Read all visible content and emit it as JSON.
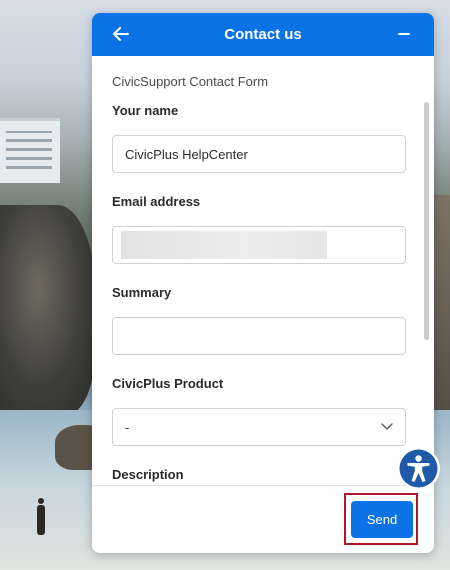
{
  "header": {
    "title": "Contact us",
    "back_icon": "arrow-left-icon",
    "minimize_icon": "minus-icon"
  },
  "form": {
    "title": "CivicSupport Contact Form",
    "fields": {
      "name": {
        "label": "Your name",
        "value": "CivicPlus HelpCenter"
      },
      "email": {
        "label": "Email address",
        "value": ""
      },
      "summary": {
        "label": "Summary",
        "value": ""
      },
      "product": {
        "label": "CivicPlus Product",
        "value": "-"
      },
      "description": {
        "label": "Description"
      }
    }
  },
  "footer": {
    "send_label": "Send"
  },
  "colors": {
    "accent": "#0b72e7",
    "highlight_border": "#b1152a",
    "accessibility_icon": "#1e5aa8"
  },
  "accessibility": {
    "icon": "accessibility-person-icon"
  }
}
